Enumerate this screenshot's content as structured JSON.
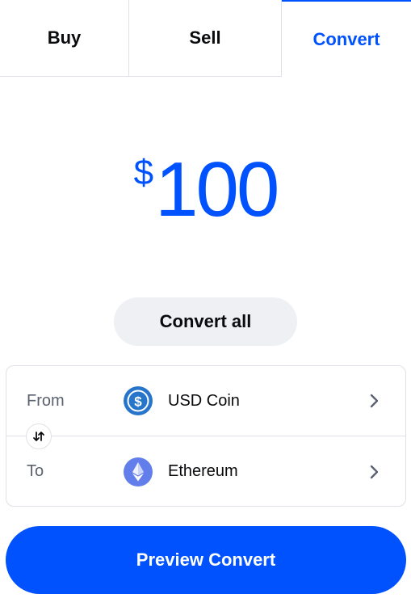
{
  "tabs": [
    {
      "label": "Buy"
    },
    {
      "label": "Sell"
    },
    {
      "label": "Convert",
      "active": true
    }
  ],
  "amount": {
    "currency_symbol": "$",
    "value": "100"
  },
  "convert_all_label": "Convert all",
  "from": {
    "label": "From",
    "asset": "USD Coin",
    "icon": "usdc-icon"
  },
  "to": {
    "label": "To",
    "asset": "Ethereum",
    "icon": "ethereum-icon"
  },
  "preview_button_label": "Preview Convert",
  "colors": {
    "accent": "#0052ff",
    "usdc": "#2775ca",
    "eth": "#627eea",
    "muted": "#5b616e",
    "chip_bg": "#eef0f3"
  }
}
